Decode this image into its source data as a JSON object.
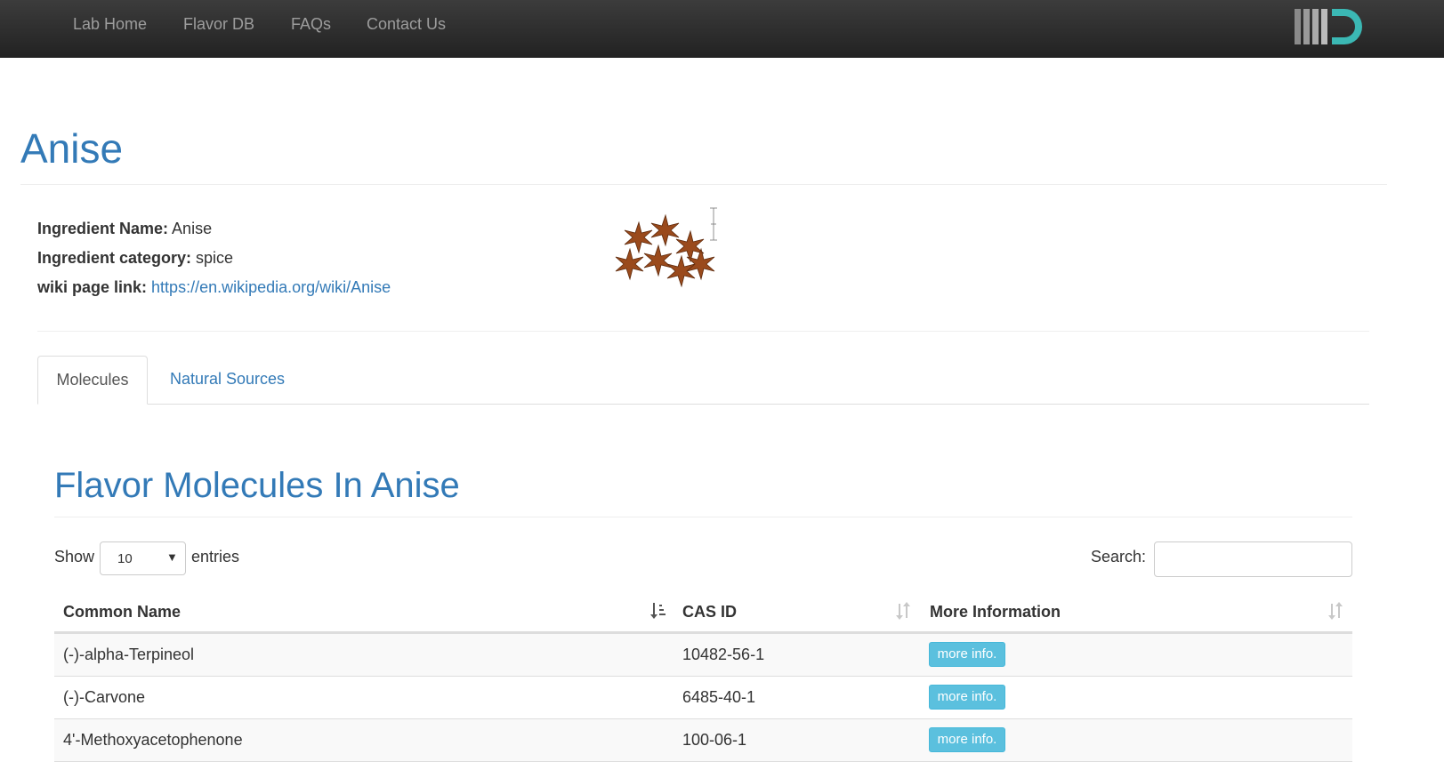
{
  "nav": {
    "items": [
      {
        "label": "Lab Home"
      },
      {
        "label": "Flavor DB"
      },
      {
        "label": "FAQs"
      },
      {
        "label": "Contact Us"
      }
    ]
  },
  "page": {
    "title": "Anise"
  },
  "ingredient": {
    "name_label": "Ingredient Name:",
    "name": "Anise",
    "category_label": "Ingredient category:",
    "category": "spice",
    "wiki_label": "wiki page link:",
    "wiki_url": "https://en.wikipedia.org/wiki/Anise"
  },
  "tabs": [
    {
      "label": "Molecules",
      "active": true
    },
    {
      "label": "Natural Sources",
      "active": false
    }
  ],
  "section": {
    "title": "Flavor Molecules In Anise"
  },
  "table_controls": {
    "show_label": "Show",
    "length_value": "10",
    "entries_label": "entries",
    "search_label": "Search:",
    "search_value": ""
  },
  "table": {
    "columns": [
      "Common Name",
      "CAS ID",
      "More Information"
    ],
    "rows": [
      {
        "name": "(-)-alpha-Terpineol",
        "cas": "10482-56-1",
        "action": "more info."
      },
      {
        "name": "(-)-Carvone",
        "cas": "6485-40-1",
        "action": "more info."
      },
      {
        "name": "4'-Methoxyacetophenone",
        "cas": "100-06-1",
        "action": "more info."
      }
    ]
  },
  "colors": {
    "accent": "#337ab7",
    "navbar": "#222222",
    "info_button": "#5bc0de"
  }
}
